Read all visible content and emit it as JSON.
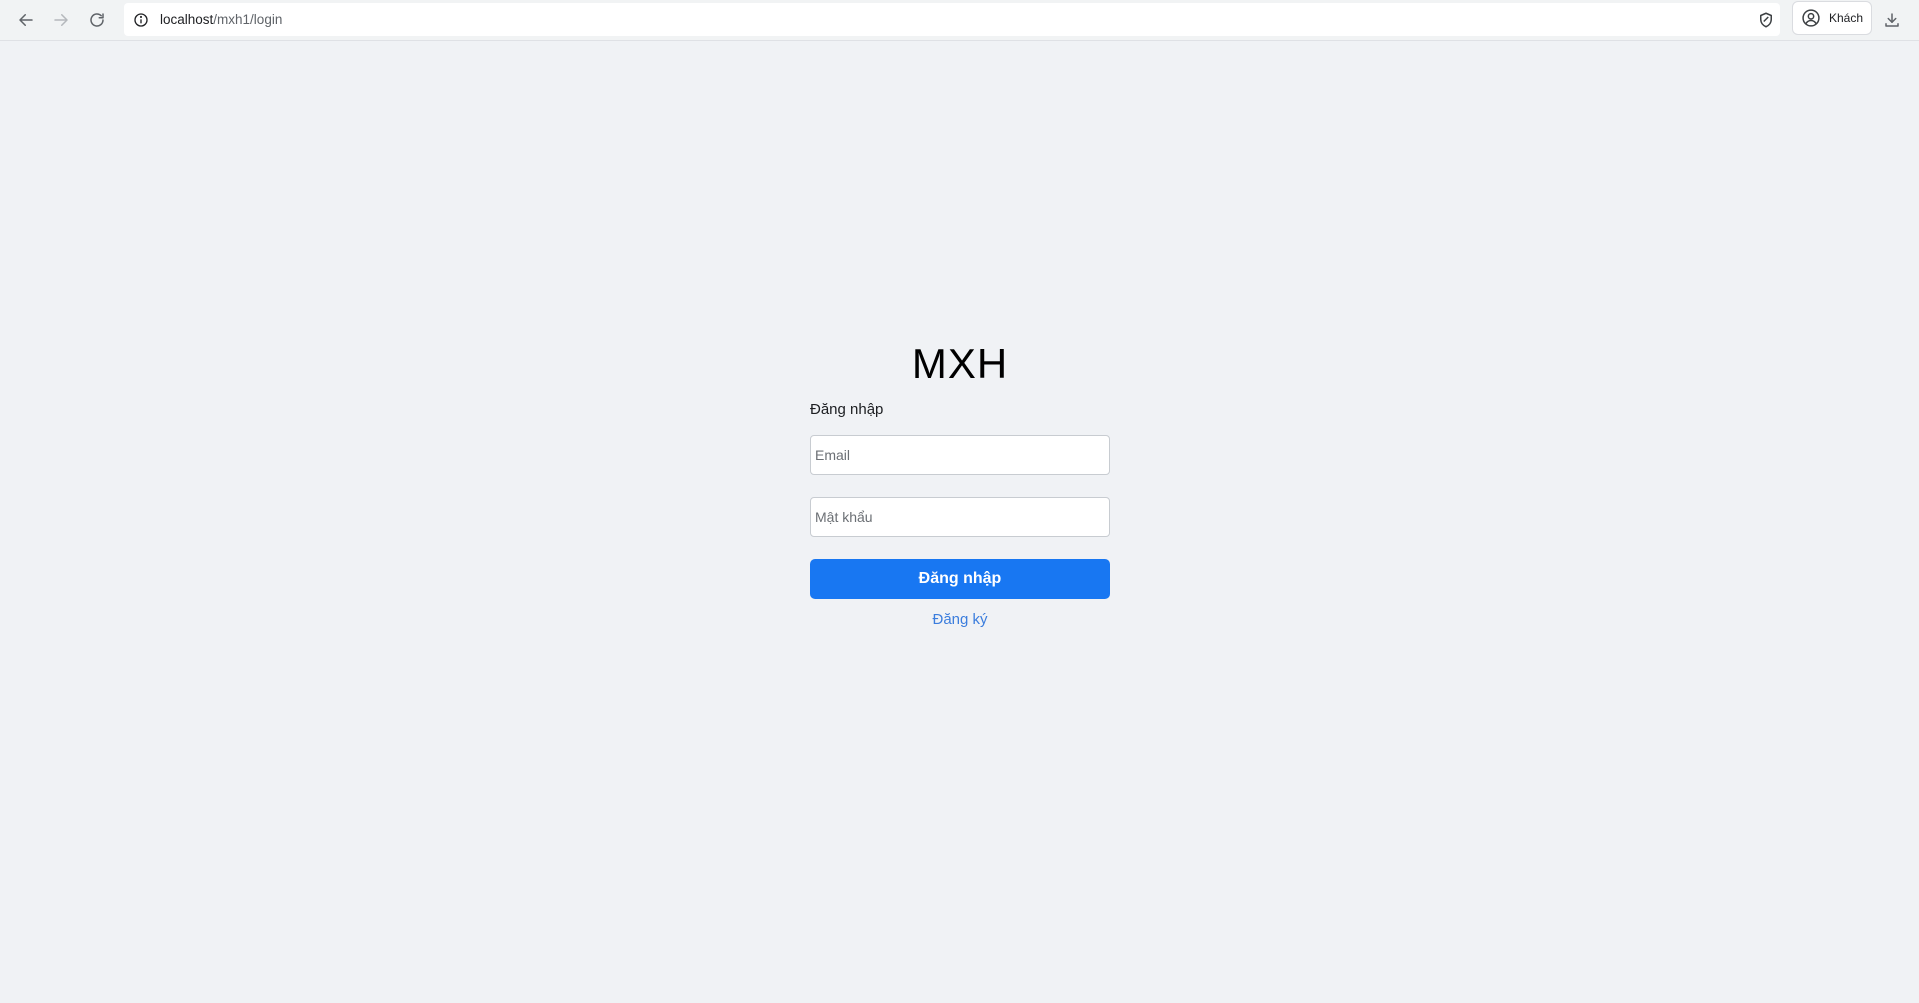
{
  "browser": {
    "url_host": "localhost",
    "url_path": "/mxh1/login",
    "profile_label": "Khách"
  },
  "page": {
    "brand": "MXH",
    "form_title": "Đăng nhập",
    "email_placeholder": "Email",
    "password_placeholder": "Mật khẩu",
    "login_button": "Đăng nhập",
    "register_link": "Đăng ký"
  },
  "colors": {
    "background": "#f0f2f5",
    "primary": "#1877f2",
    "link": "#3b7ddd"
  }
}
